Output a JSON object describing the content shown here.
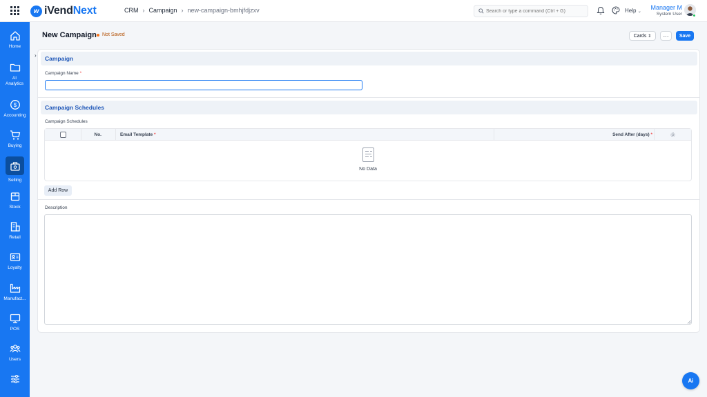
{
  "app": {
    "logo_prefix": "iVend",
    "logo_suffix": "Next",
    "logo_mark": "w"
  },
  "breadcrumb": {
    "items": [
      "CRM",
      "Campaign"
    ],
    "current": "new-campaign-bmhjfdjzxv"
  },
  "search": {
    "placeholder": "Search or type a command (Ctrl + G)"
  },
  "header": {
    "help_label": "Help",
    "user_name": "Manager M",
    "user_role": "System User"
  },
  "sidebar": {
    "items": [
      {
        "label": "Home",
        "icon": "home-icon"
      },
      {
        "label": "AI Analytics",
        "icon": "folder-icon"
      },
      {
        "label": "Accounting",
        "icon": "dollar-icon"
      },
      {
        "label": "Buying",
        "icon": "cart-icon"
      },
      {
        "label": "Selling",
        "icon": "selling-icon",
        "active": true
      },
      {
        "label": "Stock",
        "icon": "box-icon"
      },
      {
        "label": "Retail",
        "icon": "retail-icon"
      },
      {
        "label": "Loyalty",
        "icon": "id-card-icon"
      },
      {
        "label": "Manufact...",
        "icon": "factory-icon"
      },
      {
        "label": "POS",
        "icon": "monitor-icon"
      },
      {
        "label": "Users",
        "icon": "users-icon"
      },
      {
        "label": "",
        "icon": "sliders-icon"
      }
    ]
  },
  "page": {
    "title": "New Campaign",
    "status": "Not Saved",
    "view_selector": "Cards",
    "more_label": "···",
    "save_label": "Save"
  },
  "form": {
    "section_campaign": "Campaign",
    "campaign_name_label": "Campaign Name",
    "campaign_name_value": "",
    "section_schedules": "Campaign Schedules",
    "schedules_label": "Campaign Schedules",
    "grid": {
      "col_no": "No.",
      "col_email_template": "Email Template",
      "col_send_after": "Send After (days)",
      "empty_text": "No Data"
    },
    "add_row_label": "Add Row",
    "description_label": "Description",
    "description_value": ""
  },
  "fab": {
    "label": "Ai"
  },
  "colors": {
    "primary": "#1877f2",
    "sidebar": "#1877f2",
    "active_item": "#0b4e9e",
    "section_text": "#1f57b8",
    "status": "#f97316"
  }
}
